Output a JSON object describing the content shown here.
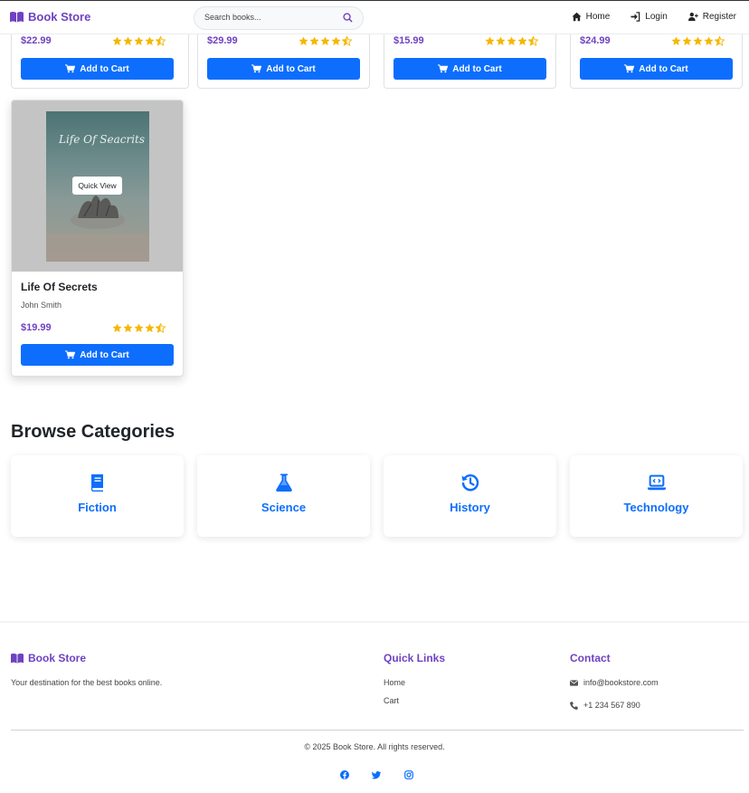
{
  "nav": {
    "brand": "Book Store",
    "search_placeholder": "Search books...",
    "links": [
      "Home",
      "Login",
      "Register"
    ]
  },
  "colors": {
    "accent": "#6f42c1",
    "primary": "#0d6efd",
    "star": "#f6b700"
  },
  "top_cards": [
    {
      "price": "$22.99",
      "rating": 4.5,
      "button": "Add to Cart"
    },
    {
      "price": "$29.99",
      "rating": 4.5,
      "button": "Add to Cart"
    },
    {
      "price": "$15.99",
      "rating": 4.5,
      "button": "Add to Cart"
    },
    {
      "price": "$24.99",
      "rating": 4.5,
      "button": "Add to Cart"
    }
  ],
  "featured_card": {
    "cover_title": "Life Of Seacrits",
    "quick_view": "Quick View",
    "title": "Life Of Secrets",
    "author": "John Smith",
    "price": "$19.99",
    "rating": 4.5,
    "button": "Add to Cart"
  },
  "categories": {
    "heading": "Browse Categories",
    "items": [
      {
        "label": "Fiction",
        "icon": "book-icon"
      },
      {
        "label": "Science",
        "icon": "flask-icon"
      },
      {
        "label": "History",
        "icon": "history-icon"
      },
      {
        "label": "Technology",
        "icon": "laptop-code-icon"
      }
    ]
  },
  "footer": {
    "brand": "Book Store",
    "tagline": "Your destination for the best books online.",
    "quick_links_heading": "Quick Links",
    "quick_links": [
      "Home",
      "Cart"
    ],
    "contact_heading": "Contact",
    "email": "info@bookstore.com",
    "phone": "+1 234 567 890",
    "copyright": "© 2025 Book Store. All rights reserved.",
    "social": [
      "facebook-icon",
      "twitter-icon",
      "instagram-icon"
    ]
  }
}
